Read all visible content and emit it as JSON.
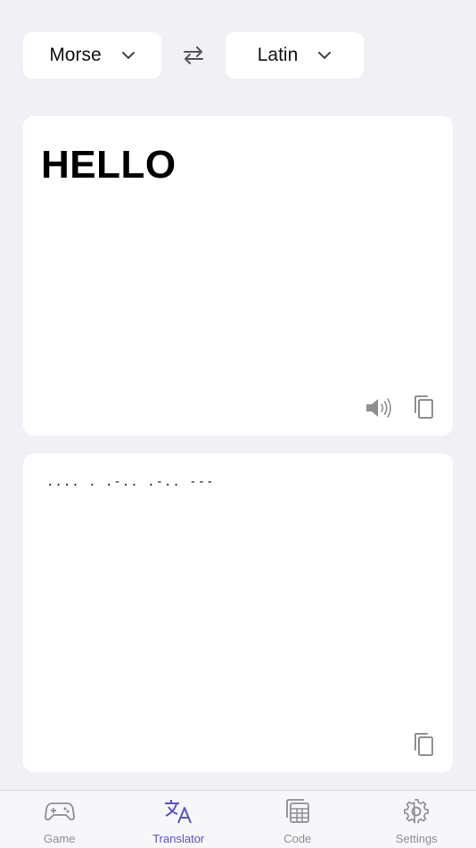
{
  "languages": {
    "source": "Morse",
    "target": "Latin"
  },
  "input": {
    "text": "HELLO"
  },
  "output": {
    "text": ".... . .-.. .-.. ---"
  },
  "colors": {
    "background": "#f1f0f5",
    "accent": "#5a50c8",
    "inactive": "#8e8e93"
  },
  "tabs": [
    {
      "label": "Game",
      "icon": "gamepad-icon"
    },
    {
      "label": "Translator",
      "icon": "translate-icon",
      "active": true
    },
    {
      "label": "Code",
      "icon": "code-table-icon"
    },
    {
      "label": "Settings",
      "icon": "gear-icon"
    }
  ]
}
